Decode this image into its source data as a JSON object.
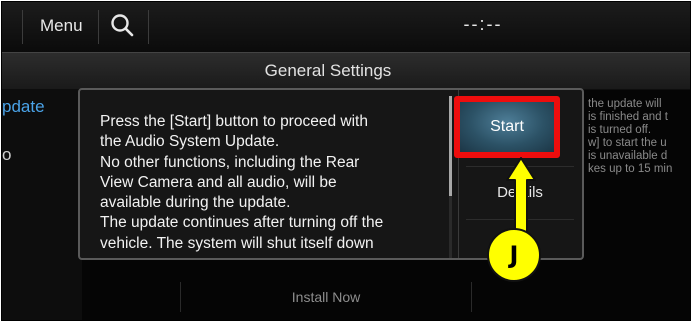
{
  "topbar": {
    "menu_label": "Menu",
    "search_icon": "search-icon",
    "clock": "--:--"
  },
  "titlebar": {
    "title": "General Settings"
  },
  "background": {
    "left_items": [
      "pdate",
      "o"
    ],
    "right_lines": [
      "the update will",
      "is finished and t",
      "is turned off.",
      "w] to start the u",
      "is unavailable d",
      "kes up to 15 min"
    ],
    "install_now": "Install Now"
  },
  "popup": {
    "message_lines": [
      "Press the [Start] button to proceed with",
      "the Audio System Update.",
      "No other functions, including the Rear",
      "View Camera and all audio, will be",
      "available during the update.",
      "The update continues after turning off the",
      "vehicle. The system will shut itself down"
    ],
    "start_label": "Start",
    "details_label": "Details"
  },
  "annotation": {
    "label": "J",
    "highlight_color": "#ee0d0d",
    "marker_color": "#ffff00"
  }
}
